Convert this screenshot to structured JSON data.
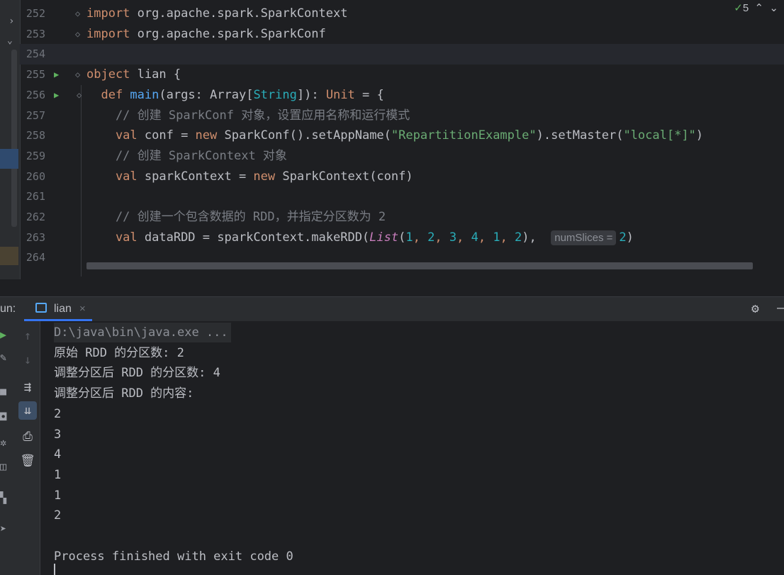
{
  "editor": {
    "inspection_count": "5",
    "lines": [
      {
        "n": "252",
        "tokens": [
          [
            "kw",
            "import"
          ],
          [
            "pk",
            " org.apache.spark.SparkContext"
          ]
        ]
      },
      {
        "n": "253",
        "tokens": [
          [
            "kw",
            "import"
          ],
          [
            "pk",
            " org.apache.spark.SparkConf"
          ]
        ]
      },
      {
        "n": "254",
        "tokens": []
      },
      {
        "n": "255",
        "tokens": [
          [
            "kw",
            "object"
          ],
          [
            "pk",
            " lian {"
          ]
        ]
      },
      {
        "n": "256",
        "tokens": [
          [
            "kw",
            "  def "
          ],
          [
            "fn",
            "main"
          ],
          [
            "pk",
            "(args: Array["
          ],
          [
            "ty",
            "String"
          ],
          [
            "pk",
            "]): "
          ],
          [
            "kw",
            "Unit"
          ],
          [
            "pk",
            " = {"
          ]
        ]
      },
      {
        "n": "257",
        "tokens": [
          [
            "cmt",
            "    // 创建 SparkConf 对象，设置应用名称和运行模式"
          ]
        ]
      },
      {
        "n": "258",
        "tokens": [
          [
            "kw",
            "    val "
          ],
          [
            "pk",
            "conf = "
          ],
          [
            "kw",
            "new "
          ],
          [
            "pk",
            "SparkConf().setAppName("
          ],
          [
            "str",
            "\"RepartitionExample\""
          ],
          [
            "pk",
            ").setMaster("
          ],
          [
            "str",
            "\"local[*]\""
          ],
          [
            "pk",
            ")"
          ]
        ]
      },
      {
        "n": "259",
        "tokens": [
          [
            "cmt",
            "    // 创建 SparkContext 对象"
          ]
        ]
      },
      {
        "n": "260",
        "tokens": [
          [
            "kw",
            "    val "
          ],
          [
            "pk",
            "sparkContext = "
          ],
          [
            "kw",
            "new "
          ],
          [
            "pk",
            "SparkContext(conf)"
          ]
        ]
      },
      {
        "n": "261",
        "tokens": []
      },
      {
        "n": "262",
        "tokens": [
          [
            "cmt",
            "    // 创建一个包含数据的 RDD，并指定分区数为 2"
          ]
        ]
      },
      {
        "n": "263",
        "tokens": [
          [
            "kw",
            "    val "
          ],
          [
            "pk",
            "dataRDD = sparkContext.makeRDD("
          ],
          [
            "ital",
            "List"
          ],
          [
            "pk",
            "("
          ],
          [
            "num",
            "1"
          ],
          [
            "kw",
            ", "
          ],
          [
            "num",
            "2"
          ],
          [
            "kw",
            ", "
          ],
          [
            "num",
            "3"
          ],
          [
            "kw",
            ", "
          ],
          [
            "num",
            "4"
          ],
          [
            "kw",
            ", "
          ],
          [
            "num",
            "1"
          ],
          [
            "kw",
            ", "
          ],
          [
            "num",
            "2"
          ],
          [
            "pk",
            "),  "
          ],
          [
            "hint",
            "numSlices ="
          ],
          [
            "num",
            "2"
          ],
          [
            "pk",
            ")"
          ]
        ]
      },
      {
        "n": "264",
        "tokens": []
      }
    ]
  },
  "run_panel": {
    "label": "un:",
    "tab_label": "lian",
    "tab_close": "×",
    "console_lines": [
      "D:\\java\\bin\\java.exe ...",
      "原始 RDD 的分区数: 2",
      "调整分区后 RDD 的分区数: 4",
      "调整分区后 RDD 的内容:",
      "2",
      "3",
      "4",
      "1",
      "1",
      "2",
      "",
      "Process finished with exit code 0"
    ]
  }
}
